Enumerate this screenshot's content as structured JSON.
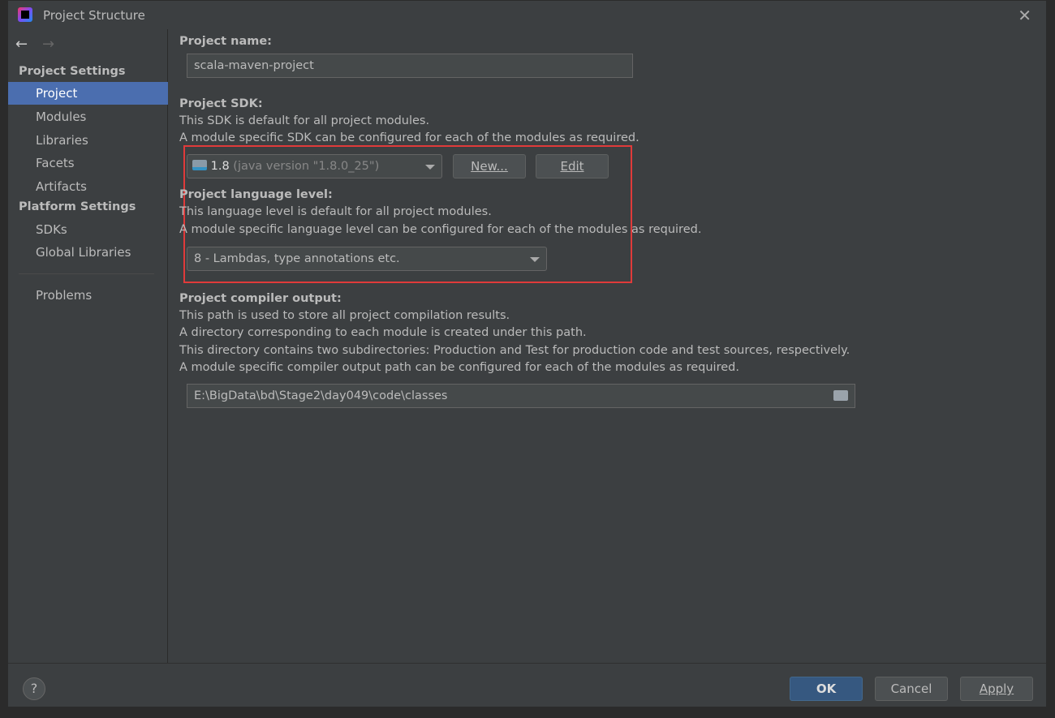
{
  "window": {
    "title": "Project Structure"
  },
  "sidebar": {
    "project_settings_header": "Project Settings",
    "project_items": [
      "Project",
      "Modules",
      "Libraries",
      "Facets",
      "Artifacts"
    ],
    "platform_settings_header": "Platform Settings",
    "platform_items": [
      "SDKs",
      "Global Libraries"
    ],
    "problems": "Problems",
    "selected": "Project"
  },
  "main": {
    "name_label": "Project name:",
    "name_value": "scala-maven-project",
    "sdk_label": "Project SDK:",
    "sdk_desc1": "This SDK is default for all project modules.",
    "sdk_desc2": "A module specific SDK can be configured for each of the modules as required.",
    "sdk_version": "1.8",
    "sdk_detail": "(java version \"1.8.0_25\")",
    "new_button": "New...",
    "edit_button": "Edit",
    "lang_label": "Project language level:",
    "lang_desc1": "This language level is default for all project modules.",
    "lang_desc2": "A module specific language level can be configured for each of the modules as required.",
    "lang_value": "8 - Lambdas, type annotations etc.",
    "out_label": "Project compiler output:",
    "out_desc1": "This path is used to store all project compilation results.",
    "out_desc2": "A directory corresponding to each module is created under this path.",
    "out_desc3": "This directory contains two subdirectories: Production and Test for production code and test sources, respectively.",
    "out_desc4": "A module specific compiler output path can be configured for each of the modules as required.",
    "out_path": "E:\\BigData\\bd\\Stage2\\day049\\code\\classes"
  },
  "footer": {
    "help": "?",
    "ok": "OK",
    "cancel": "Cancel",
    "apply": "Apply"
  },
  "colors": {
    "selection": "#4b6eaf",
    "highlight_box": "#e03a3a",
    "ok_button": "#365880"
  }
}
